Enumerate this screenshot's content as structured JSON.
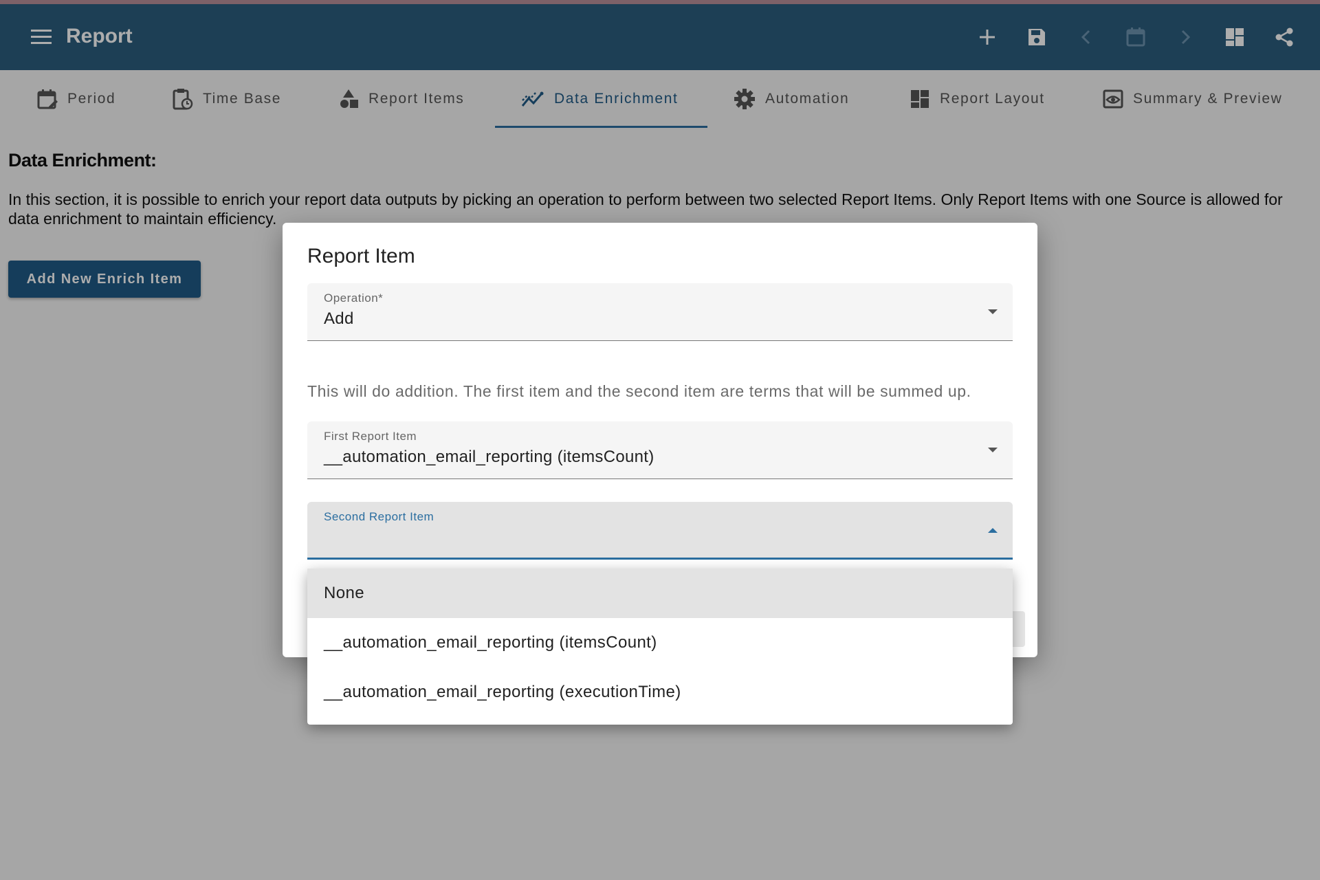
{
  "app": {
    "title": "Report",
    "toolbar": [
      "add-icon",
      "save-icon",
      "prev-icon",
      "calendar-icon",
      "next-icon",
      "layout-icon",
      "share-icon"
    ]
  },
  "tabs": [
    {
      "label": "Period",
      "icon": "calendar-edit-icon"
    },
    {
      "label": "Time Base",
      "icon": "clipboard-clock-icon"
    },
    {
      "label": "Report Items",
      "icon": "shapes-icon"
    },
    {
      "label": "Data Enrichment",
      "icon": "chart-line-icon",
      "active": true
    },
    {
      "label": "Automation",
      "icon": "gear-icon"
    },
    {
      "label": "Report Layout",
      "icon": "dashboard-icon"
    },
    {
      "label": "Summary & Preview",
      "icon": "eye-icon"
    }
  ],
  "content": {
    "title": "Data Enrichment:",
    "description": "In this section, it is possible to enrich your report data outputs by picking an operation to perform between two selected Report Items. Only Report Items with one Source is allowed for data enrichment to maintain efficiency.",
    "add_button": "Add New Enrich Item"
  },
  "dialog": {
    "title": "Report Item",
    "operation": {
      "label": "Operation*",
      "value": "Add"
    },
    "hint": "This will do addition. The first item and the second item are terms that will be summed up.",
    "first_item": {
      "label": "First Report Item",
      "value": "__automation_email_reporting (itemsCount)"
    },
    "second_item": {
      "label": "Second Report Item",
      "value": ""
    }
  },
  "dropdown": {
    "options": [
      "None",
      "__automation_email_reporting (itemsCount)",
      "__automation_email_reporting (executionTime)"
    ],
    "highlighted": "None"
  },
  "colors": {
    "appbar": "#2b5d7e",
    "accent": "#2b6ea0",
    "button": "#1f5a86"
  }
}
